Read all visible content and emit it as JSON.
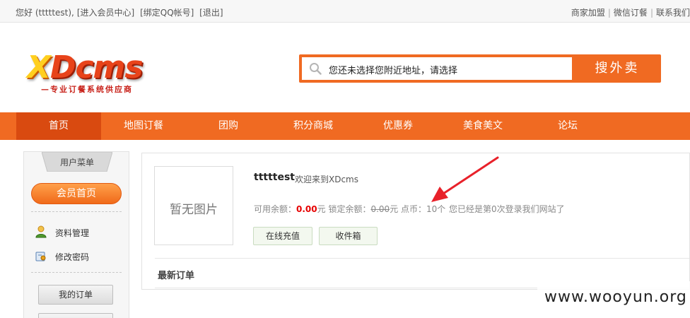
{
  "topbar": {
    "greeting": "您好 (tttttest),",
    "member_center": "[进入会员中心]",
    "bind_qq": "[绑定QQ帐号]",
    "logout": "[退出]",
    "right_links": [
      "商家加盟",
      "微信订餐",
      "联系我们"
    ]
  },
  "logo": {
    "text_x": "X",
    "text_rest": "Dcms",
    "slogan": "—专业订餐系统供应商"
  },
  "search": {
    "placeholder": "您还未选择您附近地址，请选择",
    "button": "搜外卖",
    "accent": "#f06a22"
  },
  "nav": {
    "items": [
      "首页",
      "地图订餐",
      "团购",
      "积分商城",
      "优惠券",
      "美食美文",
      "论坛"
    ],
    "active_index": 0
  },
  "sidebar": {
    "title": "用户菜单",
    "main_button": "会员首页",
    "links": [
      "资料管理",
      "修改密码"
    ],
    "buttons": [
      "我的订单",
      ""
    ]
  },
  "profile": {
    "avatar_text": "暂无图片",
    "username": "tttttest",
    "welcome": "欢迎来到XDcms",
    "available_label": "可用余额：",
    "available_value": "0.00",
    "available_unit": "元",
    "locked_label": " 锁定余额：",
    "locked_value": "0.00",
    "locked_unit": "元",
    "points_label": " 点币：",
    "points_value": "10个",
    "login_info": "您已经是第0次登录我们网站了",
    "recharge_button": "在线充值",
    "inbox_button": "收件箱",
    "orders_title": "最新订单"
  },
  "watermark": "www.wooyun.org",
  "colors": {
    "accent": "#f06a22",
    "nav_active": "#d94a10",
    "balance_red": "#e60000",
    "arrow": "#e8212a"
  }
}
